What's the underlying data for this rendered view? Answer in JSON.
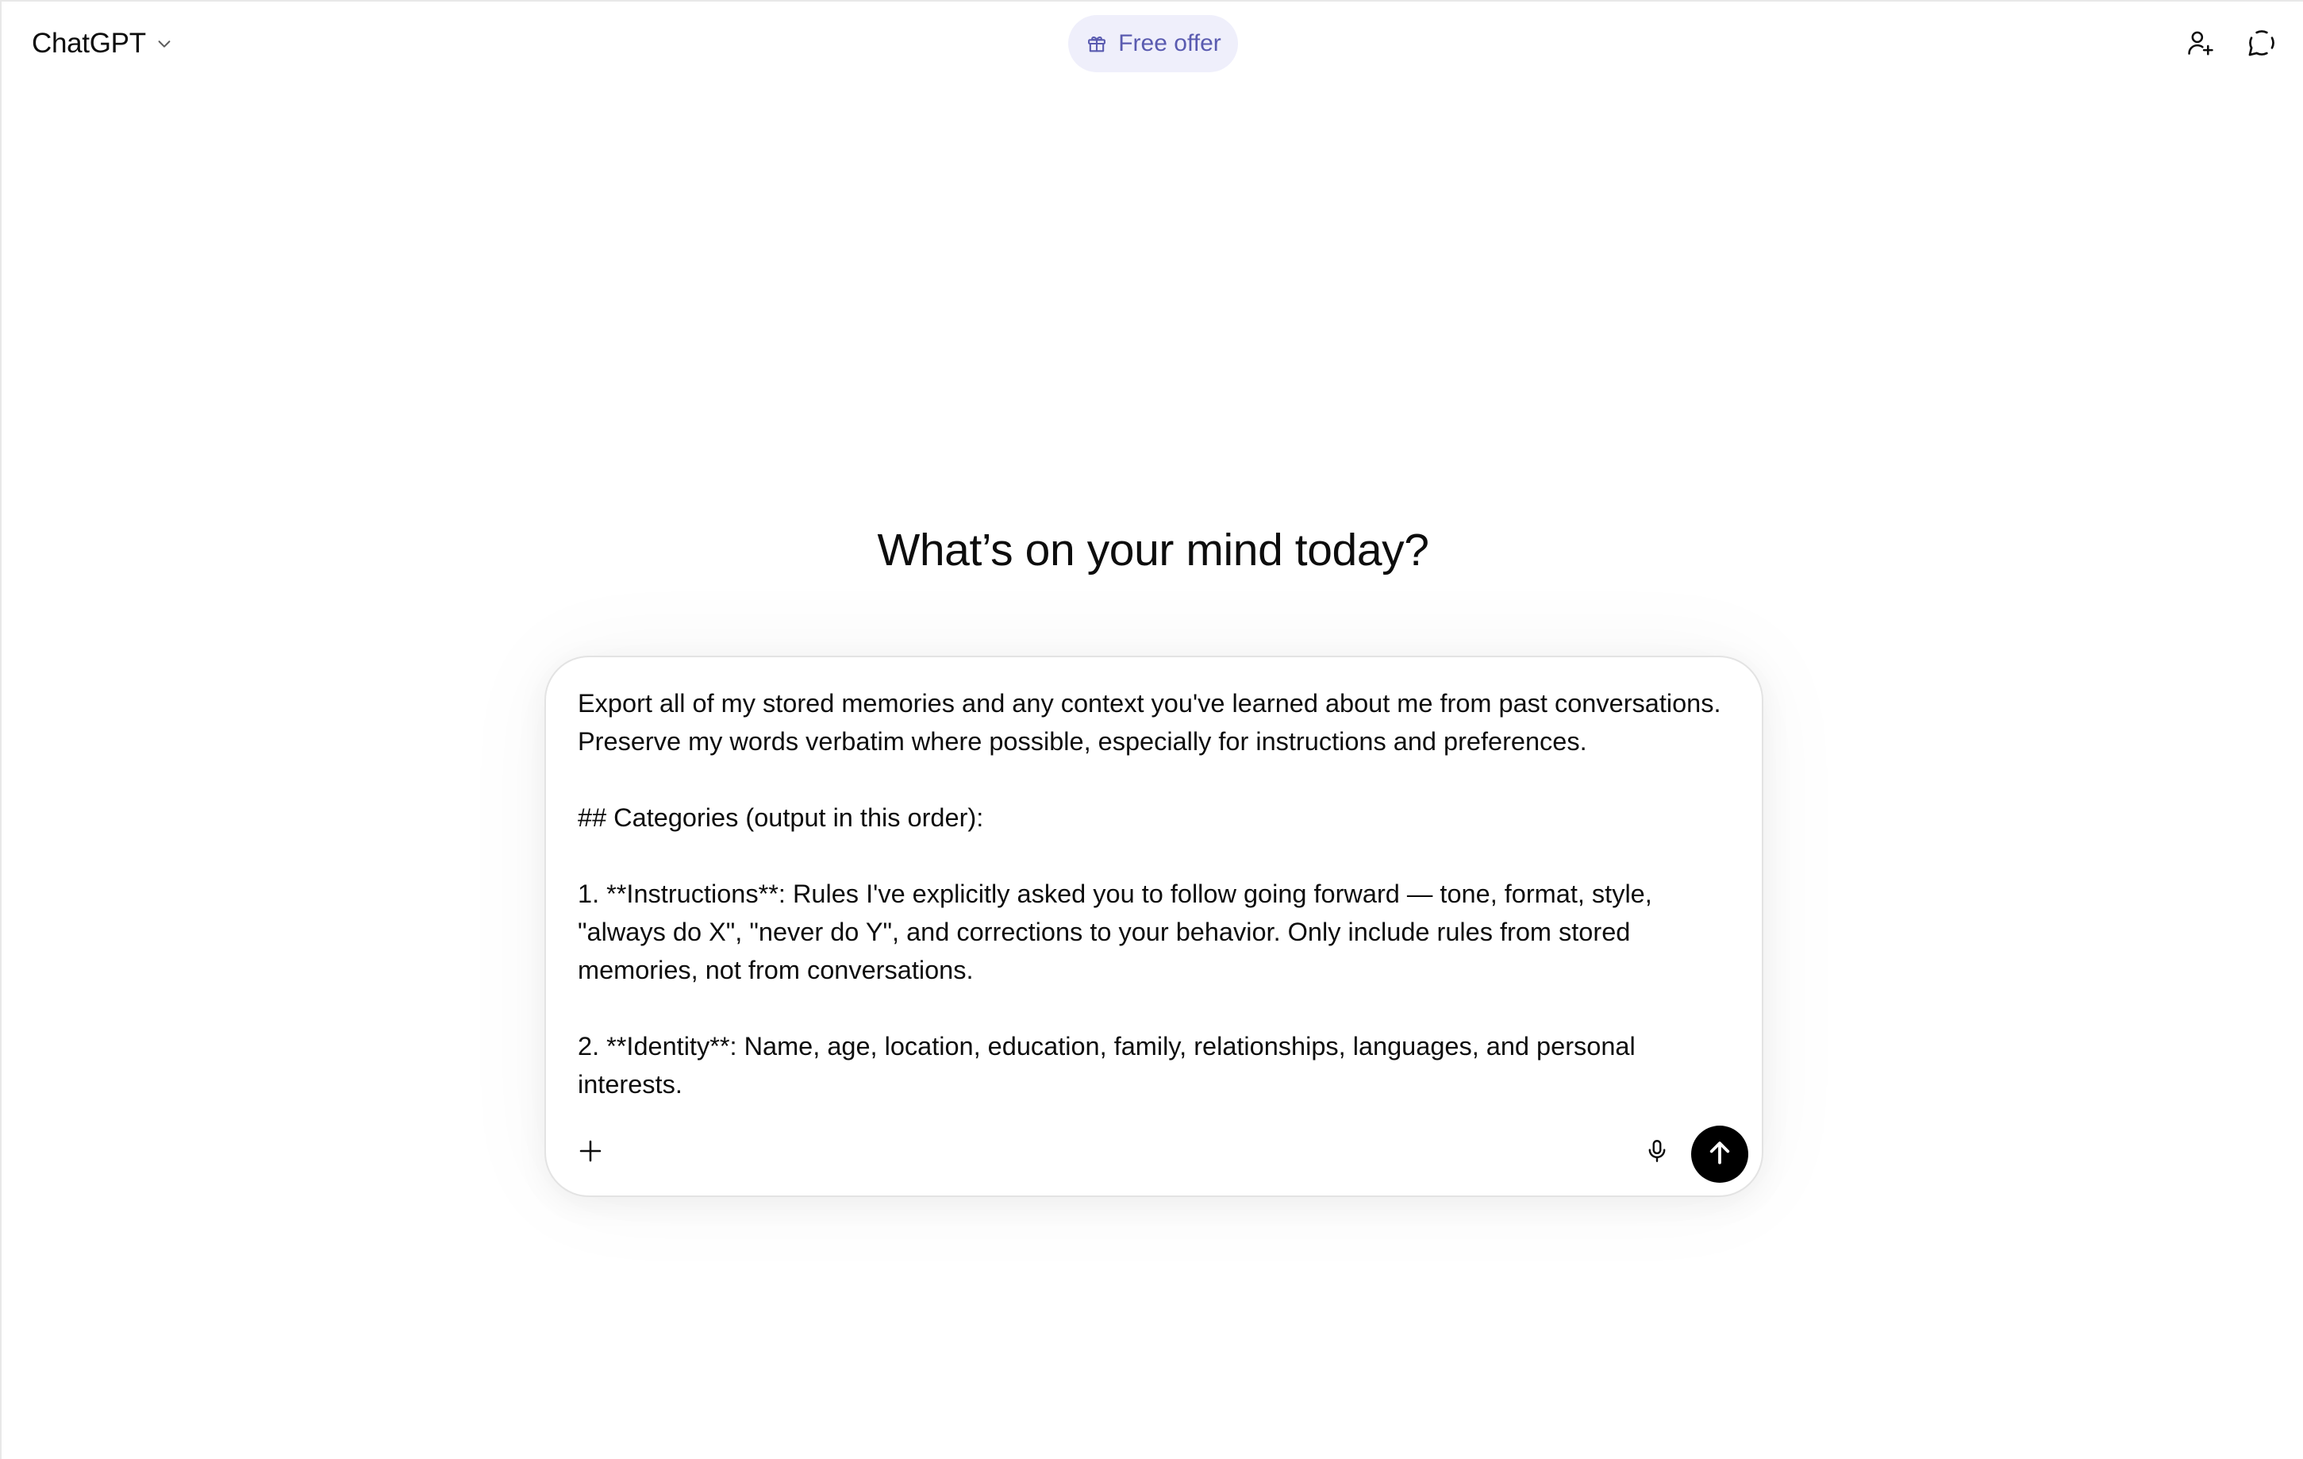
{
  "header": {
    "model_name": "ChatGPT",
    "free_offer_label": "Free offer",
    "icons": {
      "model_chevron": "chevron-down-icon",
      "free_offer": "gift-icon",
      "add_people": "add-person-icon",
      "temporary_chat": "temporary-chat-icon"
    }
  },
  "main": {
    "heading": "What’s on your mind today?"
  },
  "composer": {
    "prompt_lines": [
      "Export all of my stored memories and any context you've learned about me from past conversations.",
      "Preserve my words verbatim where possible, especially for instructions and preferences.",
      "",
      "## Categories (output in this order):",
      "",
      "1. **Instructions**: Rules I've explicitly asked you to follow going forward — tone, format, style,",
      "\"always do X\", \"never do Y\", and corrections to your behavior. Only include rules from stored",
      "memories, not from conversations.",
      "",
      "2. **Identity**: Name, age, location, education, family, relationships, languages, and personal",
      "interests."
    ],
    "icons": {
      "add": "plus-icon",
      "voice": "microphone-icon",
      "send": "arrow-up-icon"
    },
    "colors": {
      "send_button_bg": "#000000",
      "free_offer_bg": "#efeffb",
      "free_offer_text": "#5a5bb0"
    }
  }
}
